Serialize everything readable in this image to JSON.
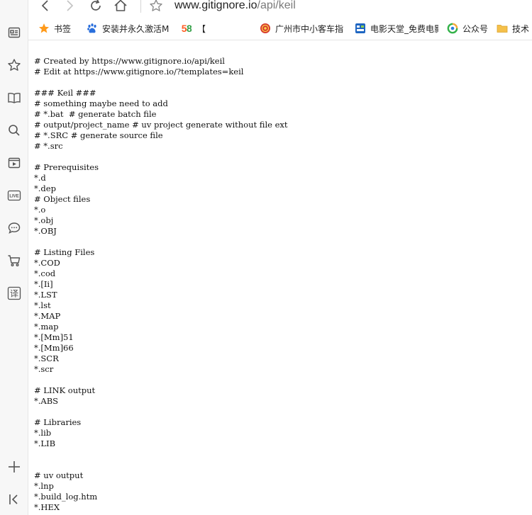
{
  "browser": {
    "url_host": "www.gitignore.io",
    "url_path": "/api/keil"
  },
  "colors": {
    "sidebar_bg": "#f7f7f7",
    "icon_stroke": "#555555",
    "bookmark_folder": "#f5c04a",
    "bookmark_star": "#ff9a1a",
    "baidu_blue": "#2a6fdc",
    "guangzhou_red": "#d63b2f",
    "movie_blue": "#1f66c2",
    "wechat_green": "#34b24a"
  },
  "sidebar": {
    "icons": [
      "reader-icon",
      "star-icon",
      "book-icon",
      "search-icon",
      "video-icon",
      "live-icon",
      "chat-icon",
      "cart-icon",
      "translate-icon",
      "plus-icon",
      "collapse-icon"
    ],
    "live_label": "LIVE",
    "translate_label": "译"
  },
  "bookmarks": {
    "items": [
      {
        "icon": "star-icon",
        "label": "书签"
      },
      {
        "icon": "baidu-paw-icon",
        "label": "安装并永久激活M"
      },
      {
        "icon": "58-logo-icon",
        "badge": "58",
        "label": "【　　　　　　】"
      },
      {
        "icon": "guangzhou-logo-icon",
        "label": "广州市中小客车指"
      },
      {
        "icon": "movie-logo-icon",
        "label": "电影天堂_免费电影"
      },
      {
        "icon": "wechat-logo-icon",
        "label": "公众号"
      },
      {
        "icon": "folder-icon",
        "label": "技术"
      }
    ]
  },
  "document": {
    "text": "# Created by https://www.gitignore.io/api/keil\n# Edit at https://www.gitignore.io/?templates=keil\n\n### Keil ###\n# something maybe need to add\n# *.bat  # generate batch file\n# output/project_name # uv project generate without file ext\n# *.SRC # generate source file\n# *.src\n\n# Prerequisites\n*.d\n*.dep\n# Object files\n*.o\n*.obj\n*.OBJ\n\n# Listing Files\n*.COD\n*.cod\n*.[Ii]\n*.LST\n*.lst\n*.MAP\n*.map\n*.[Mm]51\n*.[Mm]66\n*.SCR\n*.scr\n\n# LINK output\n*.ABS\n\n# Libraries\n*.lib\n*.LIB\n\n\n# uv output\n*.lnp\n*.build_log.htm\n*.HEX"
  }
}
